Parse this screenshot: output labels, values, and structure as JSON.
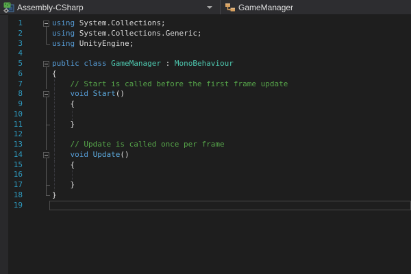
{
  "navbar": {
    "project_selector": {
      "label": "Assembly-CSharp",
      "icon": "csharp-project-icon"
    },
    "type_selector": {
      "label": "GameManager",
      "icon": "class-icon"
    }
  },
  "editor": {
    "language": "C#",
    "lines": [
      {
        "num": "1",
        "outline": "box",
        "guides": [],
        "tokens": [
          {
            "c": "kw",
            "s": "using "
          },
          {
            "c": "pl",
            "s": "System.Collections;"
          }
        ]
      },
      {
        "num": "2",
        "outline": "line",
        "guides": [],
        "tokens": [
          {
            "c": "kw",
            "s": "using "
          },
          {
            "c": "pl",
            "s": "System.Collections.Generic;"
          }
        ]
      },
      {
        "num": "3",
        "outline": "end",
        "guides": [],
        "tokens": [
          {
            "c": "kw",
            "s": "using "
          },
          {
            "c": "pl",
            "s": "UnityEngine;"
          }
        ]
      },
      {
        "num": "4",
        "outline": "",
        "guides": [],
        "tokens": []
      },
      {
        "num": "5",
        "outline": "box",
        "guides": [],
        "tokens": [
          {
            "c": "kw",
            "s": "public class "
          },
          {
            "c": "ty",
            "s": "GameManager"
          },
          {
            "c": "pl",
            "s": " : "
          },
          {
            "c": "ty",
            "s": "MonoBehaviour"
          }
        ]
      },
      {
        "num": "6",
        "outline": "line",
        "guides": [],
        "tokens": [
          {
            "c": "pl",
            "s": "{"
          }
        ]
      },
      {
        "num": "7",
        "outline": "line",
        "guides": [
          0
        ],
        "tokens": [
          {
            "c": "cm",
            "s": "    // Start is called before the first frame update"
          }
        ]
      },
      {
        "num": "8",
        "outline": "box",
        "guides": [
          0
        ],
        "tokens": [
          {
            "c": "kw",
            "s": "    void "
          },
          {
            "c": "fn",
            "s": "Start"
          },
          {
            "c": "pl",
            "s": "()"
          }
        ]
      },
      {
        "num": "9",
        "outline": "line",
        "guides": [
          0
        ],
        "tokens": [
          {
            "c": "pl",
            "s": "    {"
          }
        ]
      },
      {
        "num": "10",
        "outline": "line",
        "guides": [
          0,
          1
        ],
        "tokens": []
      },
      {
        "num": "11",
        "outline": "mid",
        "guides": [
          0
        ],
        "tokens": [
          {
            "c": "pl",
            "s": "    }"
          }
        ]
      },
      {
        "num": "12",
        "outline": "line",
        "guides": [
          0
        ],
        "tokens": []
      },
      {
        "num": "13",
        "outline": "line",
        "guides": [
          0
        ],
        "tokens": [
          {
            "c": "cm",
            "s": "    // Update is called once per frame"
          }
        ]
      },
      {
        "num": "14",
        "outline": "box",
        "guides": [
          0
        ],
        "tokens": [
          {
            "c": "kw",
            "s": "    void "
          },
          {
            "c": "fn",
            "s": "Update"
          },
          {
            "c": "pl",
            "s": "()"
          }
        ]
      },
      {
        "num": "15",
        "outline": "line",
        "guides": [
          0
        ],
        "tokens": [
          {
            "c": "pl",
            "s": "    {"
          }
        ]
      },
      {
        "num": "16",
        "outline": "line",
        "guides": [
          0,
          1
        ],
        "tokens": []
      },
      {
        "num": "17",
        "outline": "mid",
        "guides": [
          0
        ],
        "tokens": [
          {
            "c": "pl",
            "s": "    }"
          }
        ]
      },
      {
        "num": "18",
        "outline": "end",
        "guides": [],
        "tokens": [
          {
            "c": "pl",
            "s": "}"
          }
        ]
      },
      {
        "num": "19",
        "outline": "",
        "guides": [],
        "tokens": [],
        "current": true
      }
    ]
  },
  "colors": {
    "kw": "#569CD6",
    "ty": "#4EC9B0",
    "fn": "#5CA9DC",
    "cm": "#57A64A",
    "pl": "#DCDCDC",
    "lnum": "#2E9BC0",
    "bg": "#1E1E1E",
    "navbar": "#2D2D30",
    "marginStrip": "#29292B",
    "outline": "#5A5A5A",
    "guide": "#3F3F46",
    "curline": "#4A4A4A",
    "navText": "#DFDFDF",
    "classIcon": "#D7A05F"
  }
}
